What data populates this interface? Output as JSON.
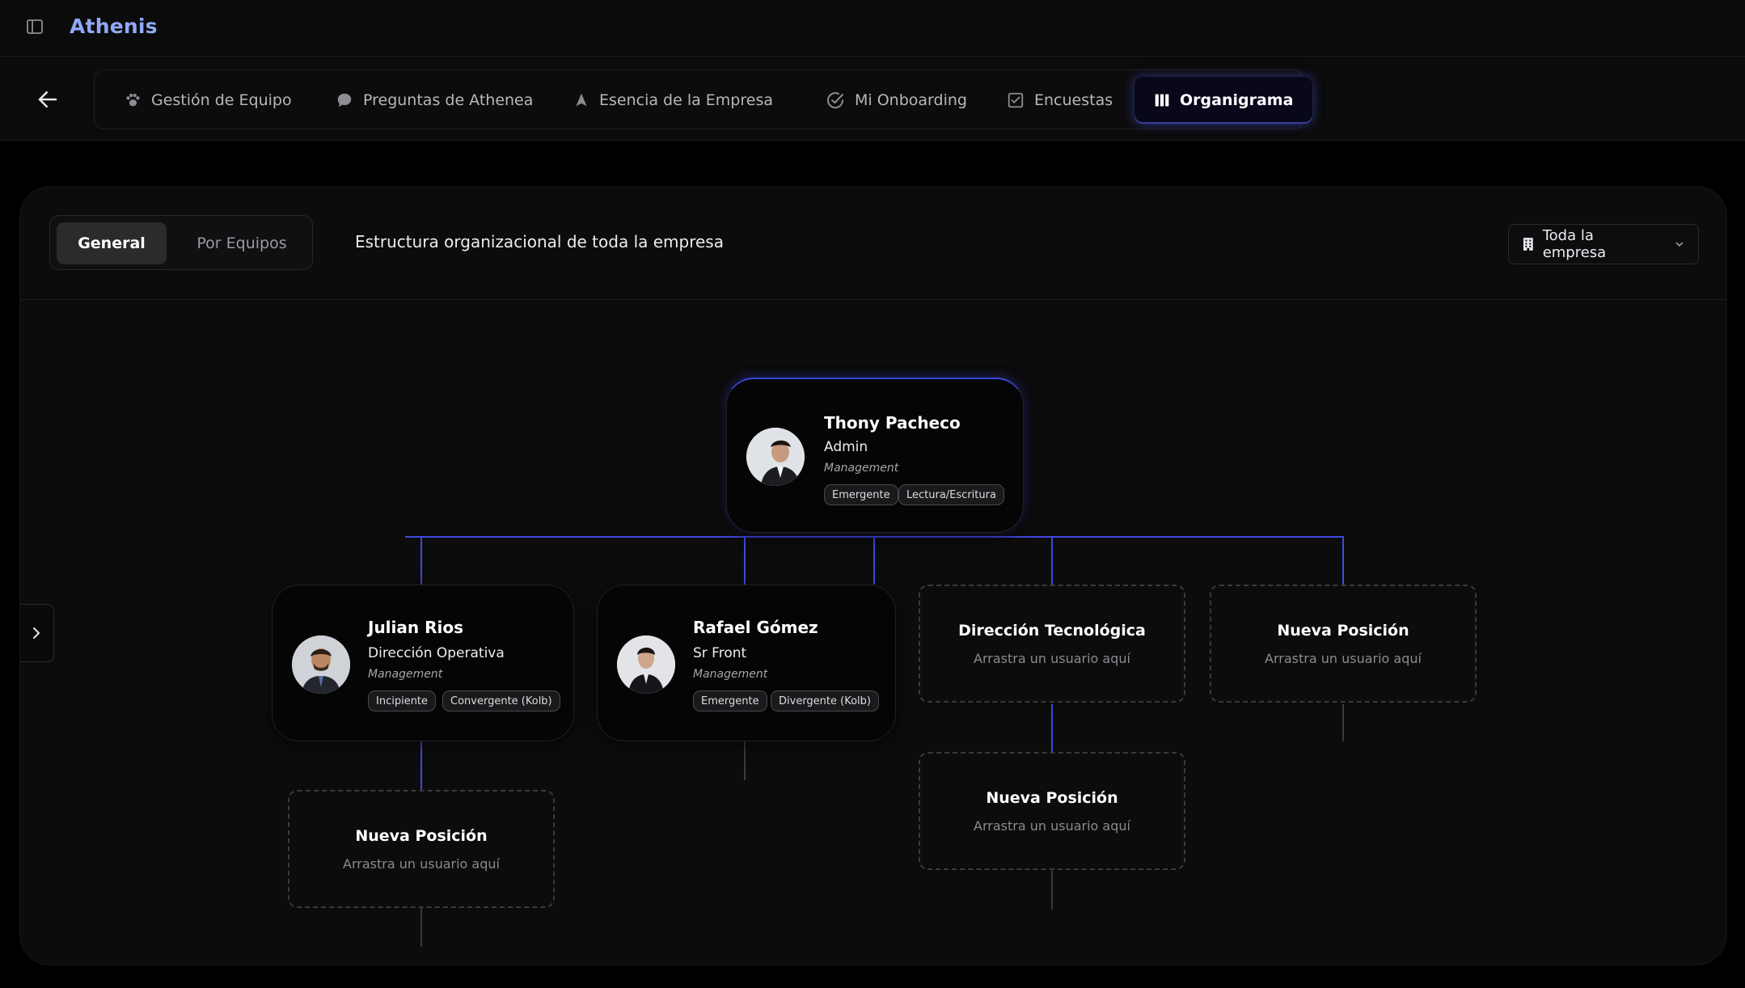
{
  "app": {
    "title": "Athenis"
  },
  "nav": {
    "tabs": [
      {
        "label": "Gestión de Equipo",
        "icon": "paw-icon"
      },
      {
        "label": "Preguntas de Athenea",
        "icon": "chat-bubble-icon"
      },
      {
        "label": "Esencia de la Empresa",
        "icon": "navigation-arrow-icon"
      },
      {
        "label": "Mi Onboarding",
        "icon": "check-circle-icon"
      },
      {
        "label": "Encuestas",
        "icon": "survey-check-icon"
      },
      {
        "label": "Organigrama",
        "icon": "org-columns-icon",
        "active": true
      }
    ]
  },
  "panel": {
    "view_toggle": {
      "general": "General",
      "por_equipos": "Por Equipos",
      "selected": "General"
    },
    "description": "Estructura organizacional de toda la empresa",
    "scope_select": {
      "value": "Toda la empresa"
    }
  },
  "org": {
    "root": {
      "name": "Thony Pacheco",
      "role": "Admin",
      "team": "Management",
      "badges": [
        "Emergente",
        "Lectura/Escritura"
      ]
    },
    "children": [
      {
        "name": "Julian Rios",
        "role": "Dirección Operativa",
        "team": "Management",
        "badges": [
          "Incipiente",
          "Convergente (Kolb)"
        ]
      },
      {
        "name": "Rafael Gómez",
        "role": "Sr Front",
        "team": "Management",
        "badges": [
          "Emergente",
          "Divergente (Kolb)"
        ]
      }
    ],
    "slots": [
      {
        "title": "Dirección Tecnológica",
        "hint": "Arrastra un usuario aquí"
      },
      {
        "title": "Nueva Posición",
        "hint": "Arrastra un usuario aquí"
      },
      {
        "title": "Nueva Posición",
        "hint": "Arrastra un usuario aquí"
      },
      {
        "title": "Nueva Posición",
        "hint": "Arrastra un usuario aquí"
      }
    ]
  },
  "colors": {
    "accent": "#8eaaf6",
    "connector_active": "#4248e0",
    "connector_muted": "#3a3a3e"
  }
}
